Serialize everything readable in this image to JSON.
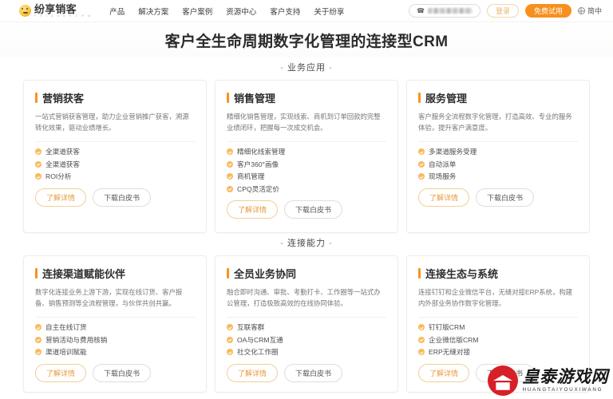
{
  "header": {
    "logo_cn": "纷享销客",
    "logo_en": "F X I A O K E  C R M",
    "nav": [
      {
        "label": "产品"
      },
      {
        "label": "解决方案"
      },
      {
        "label": "客户案例"
      },
      {
        "label": "资源中心"
      },
      {
        "label": "客户支持"
      },
      {
        "label": "关于纷享"
      }
    ],
    "phone_icon": "phone-icon",
    "phone_value": "",
    "login_label": "登录",
    "trial_label": "免费试用",
    "lang_label": "简中",
    "lang_icon": "globe-icon"
  },
  "hero": {
    "title": "客户全生命周期数字化管理的连接型CRM"
  },
  "sections": [
    {
      "label": "业务应用",
      "dash_left": "-",
      "dash_right": "-",
      "cards": [
        {
          "title": "营销获客",
          "desc": "一站式营销获客管理，助力企业营销推广获客，溯源转化效果，驱动业绩增长。",
          "features": [
            "全渠道获客",
            "全渠道获客",
            "ROI分析"
          ],
          "detail_label": "了解详情",
          "whitepaper_label": "下载白皮书"
        },
        {
          "title": "销售管理",
          "desc": "精细化销售管理，实现线索、商机到订单回款的完整业绩闭环，把握每一次成交机会。",
          "features": [
            "精细化线索管理",
            "客户360°画像",
            "商机管理",
            "CPQ灵活定价"
          ],
          "detail_label": "了解详情",
          "whitepaper_label": "下载白皮书"
        },
        {
          "title": "服务管理",
          "desc": "客户服务全流程数字化管理，打造高效、专业的服务体验，提升客户满意度。",
          "features": [
            "多渠道服务受理",
            "自动派单",
            "现场服务"
          ],
          "detail_label": "了解详情",
          "whitepaper_label": "下载白皮书"
        }
      ]
    },
    {
      "label": "连接能力",
      "dash_left": "-",
      "dash_right": "-",
      "cards": [
        {
          "title": "连接渠道赋能伙伴",
          "desc": "数字化连接业务上游下游，实现在线订货、客户报备、销售预测等全流程管理，与伙伴共创共赢。",
          "features": [
            "自主在线订货",
            "营销活动与费用核销",
            "渠道培训赋能"
          ],
          "detail_label": "了解详情",
          "whitepaper_label": "下载白皮书"
        },
        {
          "title": "全员业务协同",
          "desc": "融合即时沟通、审批、考勤打卡、工作圈等一站式办公管理，打造极致高效的在线协同体验。",
          "features": [
            "互联客群",
            "OA与CRM互通",
            "社交化工作圈"
          ],
          "detail_label": "了解详情",
          "whitepaper_label": "下载白皮书"
        },
        {
          "title": "连接生态与系统",
          "desc": "连接钉钉和企业微信平台，无缝对接ERP系统，构建内外部业务协作数字化管理。",
          "features": [
            "钉钉版CRM",
            "企业微信版CRM",
            "ERP无缝对接"
          ],
          "detail_label": "了解详情",
          "whitepaper_label": "下载白皮书"
        }
      ]
    }
  ],
  "watermark": {
    "cn": "皇泰游戏网",
    "en": "HUANGTAIYOUXIWANG"
  },
  "colors": {
    "accent": "#f7901e",
    "accent_soft": "#f7ba5b",
    "watermark_red": "#d71f27"
  }
}
